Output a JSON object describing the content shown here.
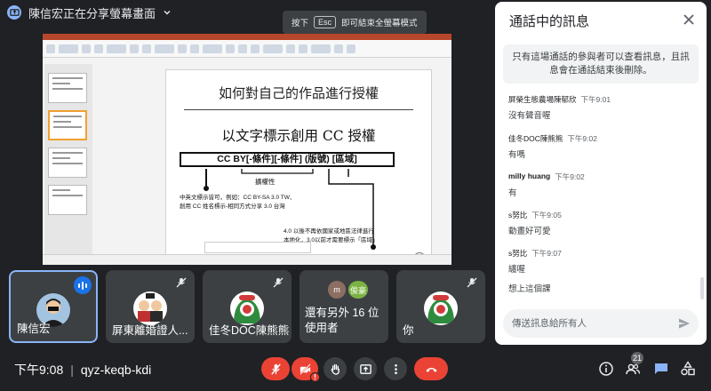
{
  "presenter": {
    "label": "陳信宏正在分享螢幕畫面"
  },
  "esc_hint": {
    "before": "按下",
    "key": "Esc",
    "after": "即可結束全螢幕模式"
  },
  "slide": {
    "title": "如何對自己的作品進行授權",
    "heading": "以文字標示創用 CC 授權",
    "formula": "CC BY[-條件][-條件] (版號) [區域]",
    "optional_label": "擴權性",
    "note_left": [
      "中英文標示皆可，例如：CC BY-SA 3.0 TW、",
      "創用 CC 姓名標示-相同方式分享 3.0 台灣"
    ],
    "note_right": [
      "4.0 以後不再依國家或地區法律進行",
      "本地化，3.0以前才需要標示「區域」"
    ]
  },
  "tiles": [
    {
      "name": "陳信宏",
      "speaking": true
    },
    {
      "name": "屏東離婚證人..."
    },
    {
      "name": "佳冬DOC陳熊熊"
    },
    {
      "name": "還有另外 16 位使用者",
      "avatar_initials": [
        "m",
        "俊豪"
      ]
    },
    {
      "name": "你"
    }
  ],
  "bottom": {
    "time": "下午9:08",
    "meeting_code": "qyz-keqb-kdi",
    "participant_count": "21"
  },
  "chat": {
    "title": "通話中的訊息",
    "notice": "只有這場通話的參與者可以查看訊息，且訊息會在通話結束後刪除。",
    "messages": [
      {
        "sender": "屏榮生態農場陳郁欣",
        "time": "下午9:01",
        "texts": [
          "沒有聲音喔"
        ]
      },
      {
        "sender": "佳冬DOC陳熊熊",
        "time": "下午9:02",
        "texts": [
          "有嗎"
        ]
      },
      {
        "sender": "milly huang",
        "time": "下午9:02",
        "texts": [
          "有"
        ]
      },
      {
        "sender": "s努比",
        "time": "下午9:05",
        "texts": [
          "動畫好可愛"
        ]
      },
      {
        "sender": "s努比",
        "time": "下午9:07",
        "texts": [
          "纏喔",
          "想上這個課"
        ]
      }
    ],
    "input_placeholder": "傳送訊息給所有人"
  },
  "colors": {
    "accent": "#8ab4f8",
    "danger": "#ea4335",
    "background": "#202124",
    "tile": "#3c4043"
  }
}
